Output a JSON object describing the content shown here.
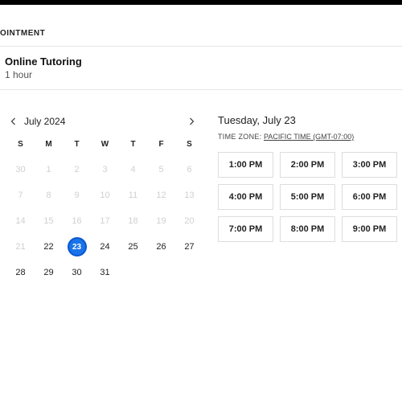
{
  "header": {
    "section": "OINTMENT"
  },
  "service": {
    "title": "Online Tutoring",
    "duration": "1 hour"
  },
  "calendar": {
    "month_label": "July 2024",
    "dow": [
      "S",
      "M",
      "T",
      "W",
      "T",
      "F",
      "S"
    ],
    "weeks": [
      [
        {
          "n": "30",
          "avail": false
        },
        {
          "n": "1",
          "avail": false
        },
        {
          "n": "2",
          "avail": false
        },
        {
          "n": "3",
          "avail": false
        },
        {
          "n": "4",
          "avail": false
        },
        {
          "n": "5",
          "avail": false
        },
        {
          "n": "6",
          "avail": false
        }
      ],
      [
        {
          "n": "7",
          "avail": false
        },
        {
          "n": "8",
          "avail": false
        },
        {
          "n": "9",
          "avail": false
        },
        {
          "n": "10",
          "avail": false
        },
        {
          "n": "11",
          "avail": false
        },
        {
          "n": "12",
          "avail": false
        },
        {
          "n": "13",
          "avail": false
        }
      ],
      [
        {
          "n": "14",
          "avail": false
        },
        {
          "n": "15",
          "avail": false
        },
        {
          "n": "16",
          "avail": false
        },
        {
          "n": "17",
          "avail": false
        },
        {
          "n": "18",
          "avail": false
        },
        {
          "n": "19",
          "avail": false
        },
        {
          "n": "20",
          "avail": false
        }
      ],
      [
        {
          "n": "21",
          "avail": false
        },
        {
          "n": "22",
          "avail": true
        },
        {
          "n": "23",
          "avail": true,
          "selected": true
        },
        {
          "n": "24",
          "avail": true
        },
        {
          "n": "25",
          "avail": true
        },
        {
          "n": "26",
          "avail": true
        },
        {
          "n": "27",
          "avail": true
        }
      ],
      [
        {
          "n": "28",
          "avail": true
        },
        {
          "n": "29",
          "avail": true
        },
        {
          "n": "30",
          "avail": true
        },
        {
          "n": "31",
          "avail": true
        },
        {
          "n": "",
          "avail": false
        },
        {
          "n": "",
          "avail": false
        },
        {
          "n": "",
          "avail": false
        }
      ]
    ]
  },
  "timepicker": {
    "date_label": "Tuesday, July 23",
    "tz_label": "TIME ZONE:",
    "tz_value": "PACIFIC TIME (GMT-07:00)",
    "slots": [
      "1:00 PM",
      "2:00 PM",
      "3:00 PM",
      "4:00 PM",
      "5:00 PM",
      "6:00 PM",
      "7:00 PM",
      "8:00 PM",
      "9:00 PM"
    ]
  }
}
